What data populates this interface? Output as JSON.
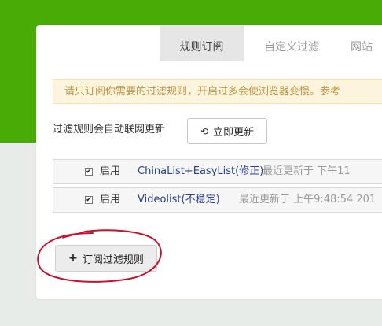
{
  "tabs": [
    {
      "label": "规则订阅",
      "active": true
    },
    {
      "label": "自定义过滤",
      "active": false
    },
    {
      "label": "网站",
      "active": false
    }
  ],
  "notice": "请只订阅你需要的过滤规则，开启过多会使浏览器变慢。参考",
  "auto_update": {
    "label": "过滤规则会自动联网更新",
    "button_label": "立即更新",
    "icon": "refresh-icon"
  },
  "rules": [
    {
      "checked": true,
      "enable_label": "启用",
      "name": "ChinaList+EasyList(修正)",
      "updated": "最近更新于 下午11"
    },
    {
      "checked": true,
      "enable_label": "启用",
      "name": "Videolist(不稳定)",
      "updated": "最近更新于 上午9:48:54 201"
    }
  ],
  "subscribe_button": {
    "label": "订阅过滤规则",
    "icon": "plus-icon"
  },
  "colors": {
    "header_green": "#49ab05",
    "notice_bg": "#fcf4dc",
    "notice_text": "#b89346",
    "link_blue": "#2a3f8f",
    "annotation_red": "#c8102e"
  }
}
